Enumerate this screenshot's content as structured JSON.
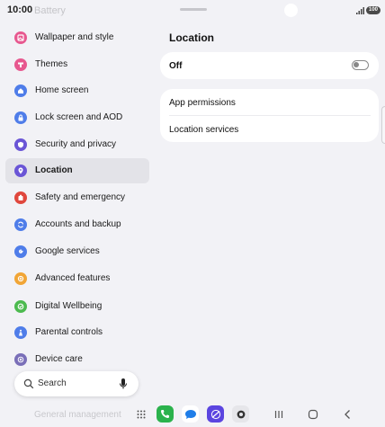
{
  "status_bar": {
    "time": "10:00",
    "battery": "100"
  },
  "sidebar": {
    "faded_top": "Battery",
    "items": [
      {
        "label": "Wallpaper and style",
        "icon": "wallpaper-icon",
        "color": "#e7588f"
      },
      {
        "label": "Themes",
        "icon": "themes-icon",
        "color": "#e7588f"
      },
      {
        "label": "Home screen",
        "icon": "home-icon",
        "color": "#4f7de9"
      },
      {
        "label": "Lock screen and AOD",
        "icon": "lock-icon",
        "color": "#4f7de9"
      },
      {
        "label": "Security and privacy",
        "icon": "shield-icon",
        "color": "#6a55d6"
      },
      {
        "label": "Location",
        "icon": "location-pin-icon",
        "color": "#6a55d6"
      },
      {
        "label": "Safety and emergency",
        "icon": "emergency-icon",
        "color": "#e0473d"
      },
      {
        "label": "Accounts and backup",
        "icon": "sync-icon",
        "color": "#4f7de9"
      },
      {
        "label": "Google services",
        "icon": "google-icon",
        "color": "#4f7de9"
      },
      {
        "label": "Advanced features",
        "icon": "gear-plus-icon",
        "color": "#f1a536"
      },
      {
        "label": "Digital Wellbeing",
        "icon": "wellbeing-icon",
        "color": "#4cba4f"
      },
      {
        "label": "Parental controls",
        "icon": "parental-icon",
        "color": "#4f7de9"
      },
      {
        "label": "Device care",
        "icon": "device-care-icon",
        "color": "#7a6fb8"
      }
    ],
    "faded_bottom": "General management",
    "search": {
      "placeholder": "Search"
    }
  },
  "main": {
    "title": "Location",
    "off_card": {
      "label": "Off",
      "toggle_on": false
    },
    "rows": [
      {
        "label": "App permissions"
      },
      {
        "label": "Location services"
      }
    ]
  },
  "dock": {
    "apps": [
      {
        "name": "phone-app-icon",
        "color": "#2bb24c"
      },
      {
        "name": "messages-app-icon",
        "color": "#1f7de8"
      },
      {
        "name": "internet-app-icon",
        "color": "#5b45e0"
      },
      {
        "name": "camera-app-icon",
        "color": "#4a4a4a"
      }
    ]
  }
}
